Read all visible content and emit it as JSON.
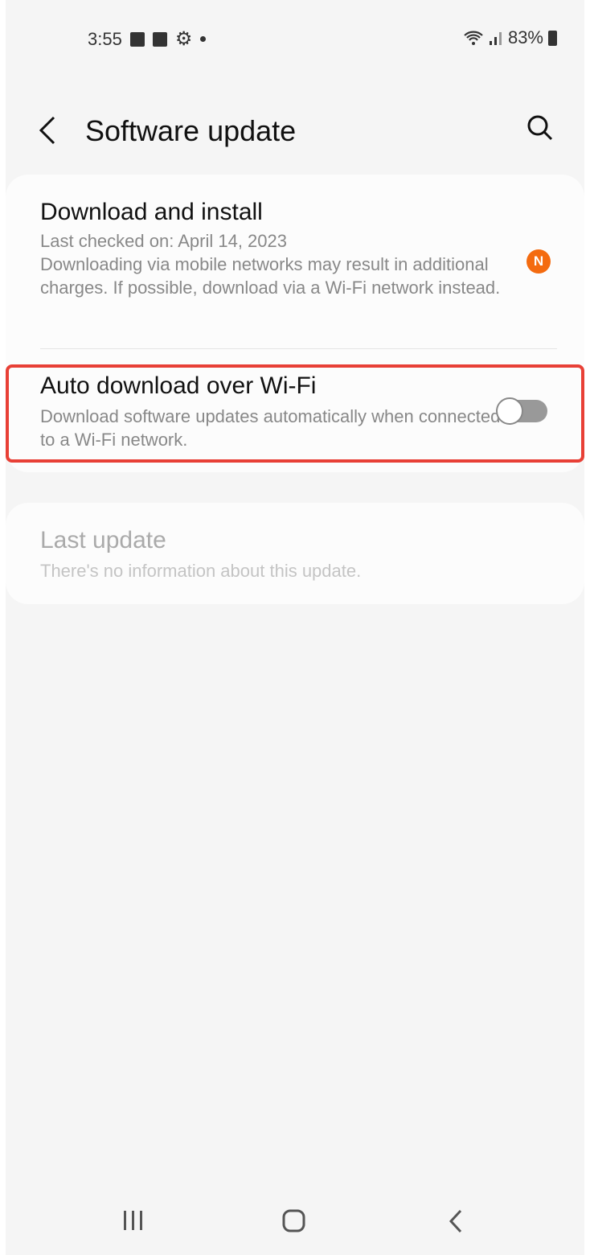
{
  "status_bar": {
    "time": "3:55",
    "battery": "83%",
    "icons": [
      "checkbox-icon",
      "gallery-icon",
      "gear-icon",
      "dot-icon",
      "wifi-icon",
      "signal-icon",
      "battery-icon"
    ]
  },
  "header": {
    "title": "Software update",
    "back_icon": "chevron-left-icon",
    "search_icon": "search-icon"
  },
  "download_install": {
    "title": "Download and install",
    "subtitle": "Last checked on: April 14, 2023",
    "note": "Downloading via mobile networks may result in additional charges. If possible, download via a Wi-Fi network instead.",
    "badge": "N",
    "badge_color": "#f46b10"
  },
  "auto_download": {
    "title": "Auto download over Wi-Fi",
    "subtitle": "Download software updates automatically when connected to a Wi-Fi network.",
    "toggle_on": false,
    "highlight_color": "#e84036"
  },
  "last_update": {
    "title": "Last update",
    "subtitle": "There's no information about this update."
  },
  "nav_bar": {
    "icons": [
      "recents-icon",
      "home-icon",
      "back-icon"
    ]
  }
}
